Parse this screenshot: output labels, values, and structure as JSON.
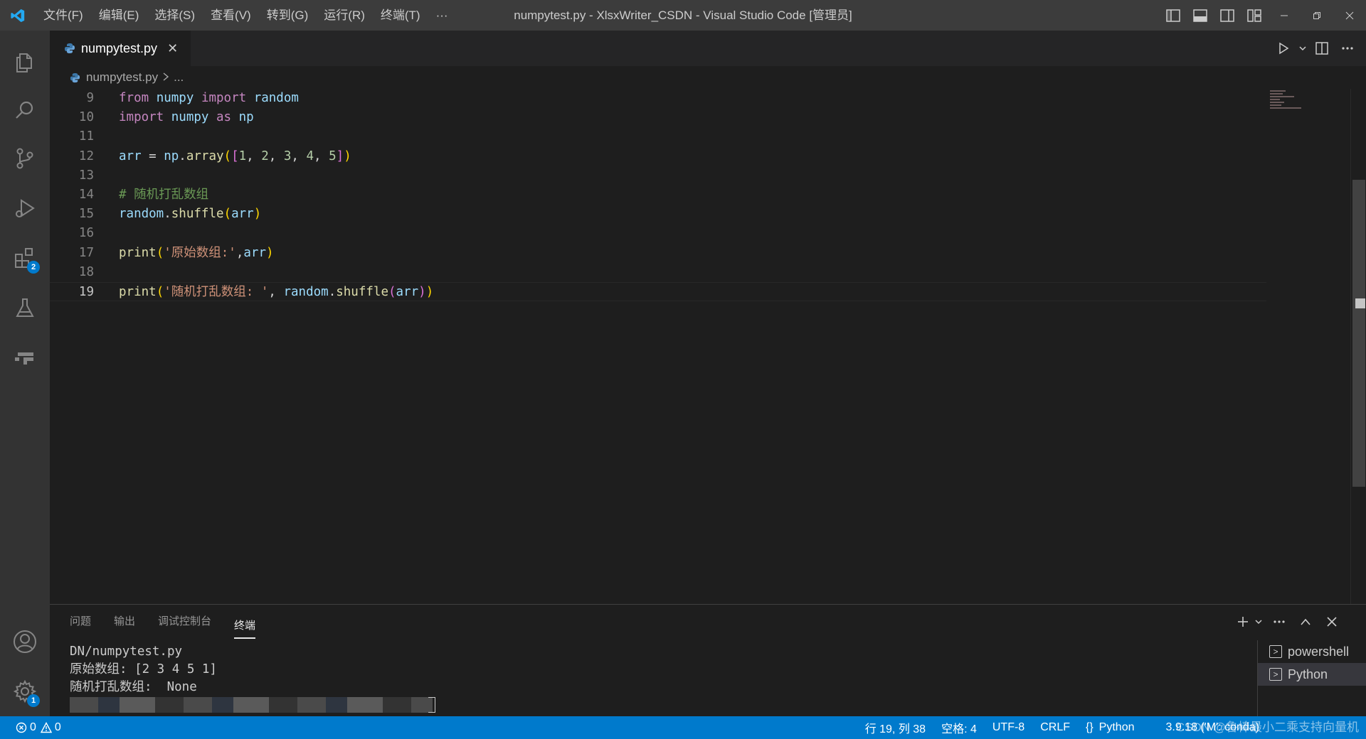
{
  "titlebar": {
    "menus": [
      "文件(F)",
      "编辑(E)",
      "选择(S)",
      "查看(V)",
      "转到(G)",
      "运行(R)",
      "终端(T)",
      "···"
    ],
    "title": "numpytest.py - XlsxWriter_CSDN - Visual Studio Code [管理员]"
  },
  "activity": {
    "extensions_badge": "2",
    "settings_badge": "1"
  },
  "tabs": [
    {
      "label": "numpytest.py",
      "close": "✕"
    }
  ],
  "breadcrumb": {
    "file": "numpytest.py",
    "rest": "..."
  },
  "editor": {
    "lines": [
      {
        "n": "9",
        "tokens": [
          [
            "kw",
            "from"
          ],
          [
            "pl",
            " "
          ],
          [
            "id",
            "numpy"
          ],
          [
            "pl",
            " "
          ],
          [
            "kw",
            "import"
          ],
          [
            "pl",
            " "
          ],
          [
            "id",
            "random"
          ]
        ]
      },
      {
        "n": "10",
        "tokens": [
          [
            "kw",
            "import"
          ],
          [
            "pl",
            " "
          ],
          [
            "id",
            "numpy"
          ],
          [
            "pl",
            " "
          ],
          [
            "kw",
            "as"
          ],
          [
            "pl",
            " "
          ],
          [
            "id",
            "np"
          ]
        ]
      },
      {
        "n": "11",
        "tokens": []
      },
      {
        "n": "12",
        "tokens": [
          [
            "id",
            "arr"
          ],
          [
            "pl",
            " = "
          ],
          [
            "id",
            "np"
          ],
          [
            "pl",
            "."
          ],
          [
            "fn",
            "array"
          ],
          [
            "br1",
            "("
          ],
          [
            "br2",
            "["
          ],
          [
            "num",
            "1"
          ],
          [
            "pl",
            ", "
          ],
          [
            "num",
            "2"
          ],
          [
            "pl",
            ", "
          ],
          [
            "num",
            "3"
          ],
          [
            "pl",
            ", "
          ],
          [
            "num",
            "4"
          ],
          [
            "pl",
            ", "
          ],
          [
            "num",
            "5"
          ],
          [
            "br2",
            "]"
          ],
          [
            "br1",
            ")"
          ]
        ]
      },
      {
        "n": "13",
        "tokens": []
      },
      {
        "n": "14",
        "tokens": [
          [
            "cm",
            "# 随机打乱数组"
          ]
        ]
      },
      {
        "n": "15",
        "tokens": [
          [
            "id",
            "random"
          ],
          [
            "pl",
            "."
          ],
          [
            "fn",
            "shuffle"
          ],
          [
            "br1",
            "("
          ],
          [
            "id",
            "arr"
          ],
          [
            "br1",
            ")"
          ]
        ]
      },
      {
        "n": "16",
        "tokens": []
      },
      {
        "n": "17",
        "tokens": [
          [
            "fn",
            "print"
          ],
          [
            "br1",
            "("
          ],
          [
            "str",
            "'原始数组:'"
          ],
          [
            "pl",
            ","
          ],
          [
            "id",
            "arr"
          ],
          [
            "br1",
            ")"
          ]
        ]
      },
      {
        "n": "18",
        "tokens": []
      },
      {
        "n": "19",
        "tokens": [
          [
            "fn",
            "print"
          ],
          [
            "br1",
            "("
          ],
          [
            "str",
            "'随机打乱数组: '"
          ],
          [
            "pl",
            ", "
          ],
          [
            "id",
            "random"
          ],
          [
            "pl",
            "."
          ],
          [
            "fn",
            "shuffle"
          ],
          [
            "br2",
            "("
          ],
          [
            "id",
            "arr"
          ],
          [
            "br2",
            ")"
          ],
          [
            "br1",
            ")"
          ]
        ]
      }
    ]
  },
  "panel": {
    "tabs": [
      "问题",
      "输出",
      "调试控制台",
      "终端"
    ],
    "active_tab": "终端",
    "terminal_lines": [
      "DN/numpytest.py",
      "原始数组: [2 3 4 5 1]",
      "随机打乱数组:  None"
    ],
    "terminals": [
      "powershell",
      "Python"
    ]
  },
  "status": {
    "errors": "0",
    "warnings": "0",
    "position": "行 19, 列 38",
    "spaces": "空格: 4",
    "encoding": "UTF-8",
    "eol": "CRLF",
    "language": "Python",
    "interpreter": "3.9.18 ('M': conda)",
    "watermark": "CSDN @鲁棒最小二乘支持向量机"
  }
}
